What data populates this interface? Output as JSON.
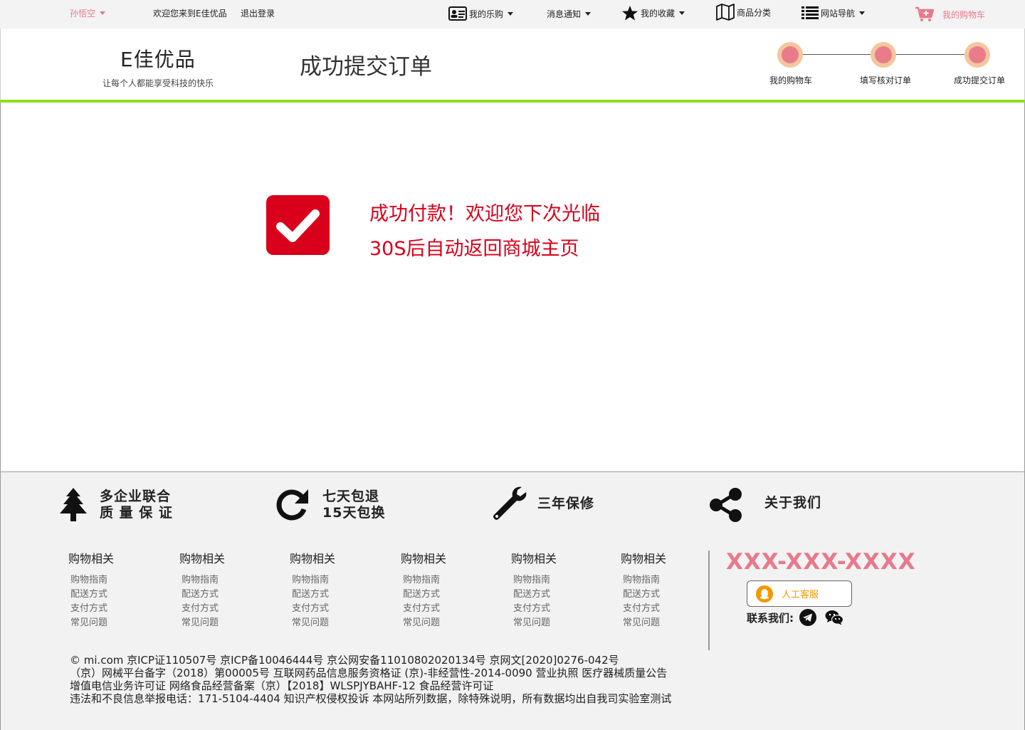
{
  "topbar": {
    "username": "孙悟空",
    "welcome": "欢迎您来到E佳优品",
    "logout": "退出登录",
    "my_lego": "我的乐购",
    "messages": "消息通知",
    "favorites": "我的收藏",
    "categories": "商品分类",
    "site_nav": "网站导航",
    "cart": "我的购物车"
  },
  "header": {
    "logo_title": "E佳优品",
    "logo_subtitle": "让每个人都能享受科技的快乐",
    "page_title": "成功提交订单",
    "steps": [
      {
        "label": "我的购物车"
      },
      {
        "label": "填写核对订单"
      },
      {
        "label": "成功提交订单"
      }
    ]
  },
  "main": {
    "message_line1": "成功付款！欢迎您下次光临",
    "message_line2": "30S后自动返回商城主页"
  },
  "footer": {
    "features": [
      {
        "line1": "多企业联合",
        "line2": "质 量 保 证",
        "icon": "tree-icon"
      },
      {
        "line1": "七天包退",
        "line2": "15天包换",
        "icon": "refresh-icon"
      },
      {
        "line1": "三年保修",
        "line2": "",
        "icon": "wrench-icon"
      },
      {
        "line1": "关于我们",
        "line2": "",
        "icon": "share-icon"
      }
    ],
    "columns": [
      {
        "title": "购物相关",
        "links": [
          "购物指南",
          "配送方式",
          "支付方式",
          "常见问题"
        ]
      },
      {
        "title": "购物相关",
        "links": [
          "购物指南",
          "配送方式",
          "支付方式",
          "常见问题"
        ]
      },
      {
        "title": "购物相关",
        "links": [
          "购物指南",
          "配送方式",
          "支付方式",
          "常见问题"
        ]
      },
      {
        "title": "购物相关",
        "links": [
          "购物指南",
          "配送方式",
          "支付方式",
          "常见问题"
        ]
      },
      {
        "title": "购物相关",
        "links": [
          "购物指南",
          "配送方式",
          "支付方式",
          "常见问题"
        ]
      },
      {
        "title": "购物相关",
        "links": [
          "购物指南",
          "配送方式",
          "支付方式",
          "常见问题"
        ]
      }
    ],
    "phone": "XXX-XXX-XXXX",
    "service_label": "人工客服",
    "contact_label": "联系我们:",
    "legal": [
      "© mi.com 京ICP证110507号 京ICP备10046444号 京公网安备11010802020134号 京网文[2020]0276-042号",
      "（京）网械平台备字（2018）第00005号 互联网药品信息服务资格证 (京)-非经营性-2014-0090 营业执照 医疗器械质量公告",
      "增值电信业务许可证 网络食品经营备案（京）【2018】WLSPJYBAHF-12  食品经营许可证",
      "违法和不良信息举报电话：171-5104-4404 知识产权侵权投诉 本网站所列数据，除特殊说明，所有数据均出自我司实验室测试"
    ]
  },
  "colors": {
    "accent_pink": "#e8798c",
    "success_red": "#d8001b",
    "green_bar": "#8fe01a",
    "step_ring": "#f2c79f"
  }
}
